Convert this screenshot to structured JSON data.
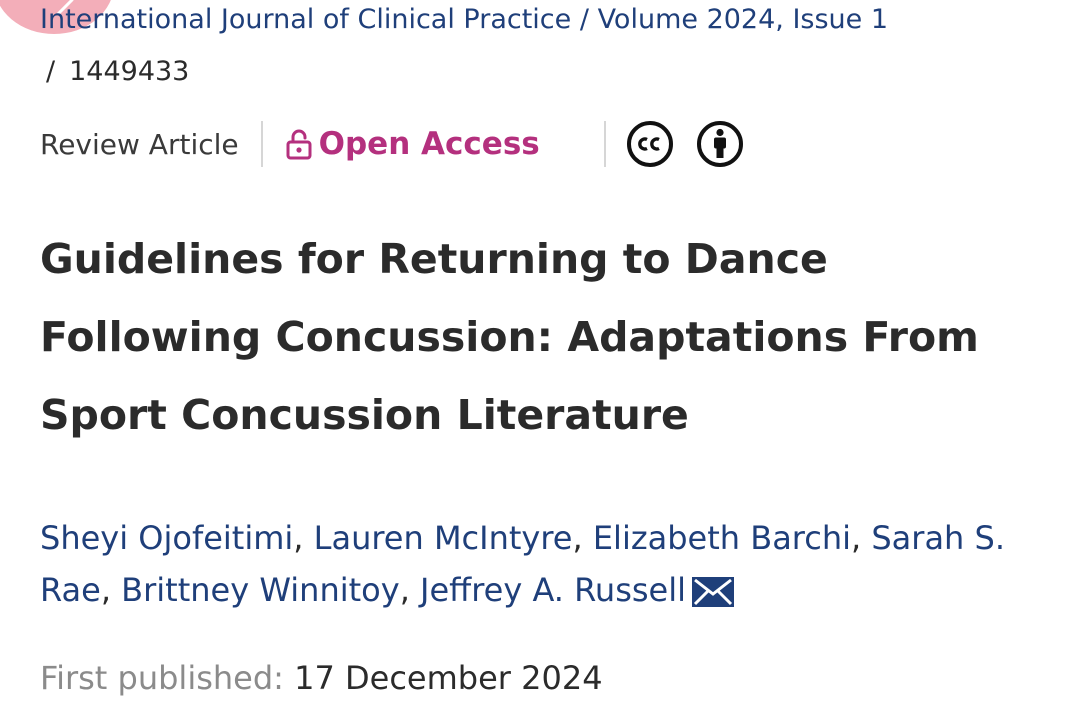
{
  "breadcrumb": {
    "journal": "International Journal of Clinical Practice",
    "separator": "/",
    "volume_issue": "Volume 2024, Issue 1",
    "article_id": "1449433"
  },
  "meta": {
    "article_type": "Review Article",
    "open_access_label": "Open Access",
    "accent_color": "#b4307e",
    "license_icons": [
      "cc-icon",
      "attribution-icon"
    ]
  },
  "article": {
    "title": "Guidelines for Returning to Dance Following Concussion: Adaptations From Sport Concussion Literature",
    "authors": [
      "Sheyi Ojofeitimi",
      "Lauren McIntyre",
      "Elizabeth Barchi",
      "Sarah S. Rae",
      "Brittney Winnitoy",
      "Jeffrey A. Russell"
    ],
    "author_separator": ",",
    "published_label": "First published:",
    "published_date": "17 December 2024"
  },
  "colors": {
    "link": "#1f3f7a",
    "text": "#2b2b2b",
    "muted": "#8b8b8b",
    "back_bubble": "#f2a1ad"
  }
}
